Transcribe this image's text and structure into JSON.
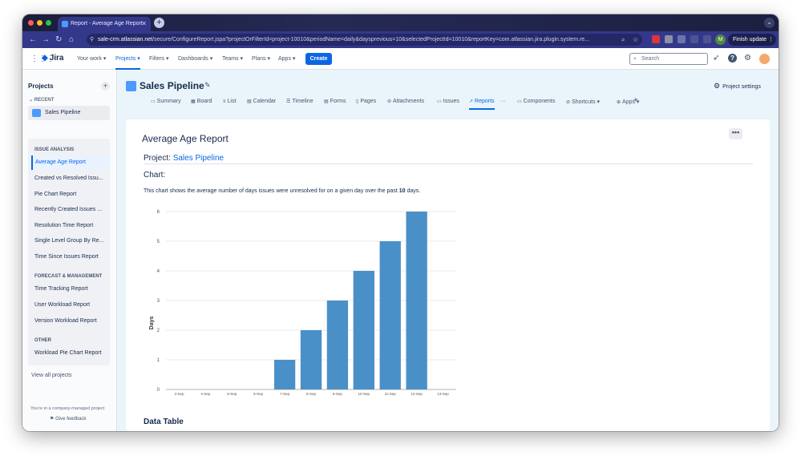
{
  "browser": {
    "tab_title": "Report - Average Age Report",
    "new_tab_symbol": "+",
    "url_host": "sale-crm.atlassian.net",
    "url_path": "/secure/ConfigureReport.jspa?projectOrFilterId=project-10010&periodName=daily&daysprevious=10&selectedProjectId=10010&reportKey=com.atlassian.jira.plugin.system.re...",
    "profile_initial": "M",
    "finish_update_label": "Finish update"
  },
  "topnav": {
    "product_name": "Jira",
    "items": [
      {
        "label": "Your work ▾"
      },
      {
        "label": "Projects ▾"
      },
      {
        "label": "Filters ▾"
      },
      {
        "label": "Dashboards ▾"
      },
      {
        "label": "Teams ▾"
      },
      {
        "label": "Plans ▾"
      },
      {
        "label": "Apps ▾"
      }
    ],
    "create_label": "Create",
    "search_placeholder": "Search"
  },
  "sidebar": {
    "title": "Projects",
    "recent_label": "RECENT",
    "project_name": "Sales Pipeline",
    "issue_analysis_label": "ISSUE ANALYSIS",
    "issue_analysis_items": [
      {
        "label": "Average Age Report"
      },
      {
        "label": "Created vs Resolved Issu..."
      },
      {
        "label": "Pie Chart Report"
      },
      {
        "label": "Recently Created Issues ..."
      },
      {
        "label": "Resolution Time Report"
      },
      {
        "label": "Single Level Group By Re..."
      },
      {
        "label": "Time Since Issues Report"
      }
    ],
    "forecast_label": "FORECAST & MANAGEMENT",
    "forecast_items": [
      {
        "label": "Time Tracking Report"
      },
      {
        "label": "User Workload Report"
      },
      {
        "label": "Version Workload Report"
      }
    ],
    "other_label": "OTHER",
    "other_items": [
      {
        "label": "Workload Pie Chart Report"
      }
    ],
    "view_all_label": "View all projects",
    "footer_text": "You're in a company-managed project",
    "feedback_label": "Give feedback"
  },
  "project": {
    "title": "Sales Pipeline",
    "settings_label": "Project settings",
    "tabs": [
      {
        "label": "Summary"
      },
      {
        "label": "Board"
      },
      {
        "label": "List"
      },
      {
        "label": "Calendar"
      },
      {
        "label": "Timeline"
      },
      {
        "label": "Forms"
      },
      {
        "label": "Pages"
      },
      {
        "label": "Attachments"
      },
      {
        "label": "Issues"
      },
      {
        "label": "Reports"
      },
      {
        "label": "···"
      },
      {
        "label": "Components"
      },
      {
        "label": "Shortcuts ▾"
      },
      {
        "label": "Apps ▾"
      }
    ]
  },
  "report": {
    "title": "Average Age Report",
    "project_label": "Project:",
    "project_link": "Sales Pipeline",
    "chart_heading": "Chart:",
    "description_prefix": "This chart shows the average number of days issues were unresolved for on a given day over the past",
    "description_days": "10",
    "description_suffix": "days.",
    "data_table_heading": "Data Table",
    "menu_symbol": "•••"
  },
  "chart_data": {
    "type": "bar",
    "categories": [
      "3-Sep",
      "4-Sep",
      "5-Sep",
      "6-Sep",
      "7-Sep",
      "8-Sep",
      "9-Sep",
      "10-Sep",
      "11-Sep",
      "12-Sep",
      "13-Sep"
    ],
    "values": [
      0,
      0,
      0,
      0,
      1,
      2,
      3,
      4,
      5,
      6,
      0
    ],
    "ylabel": "Days",
    "ylim": [
      0,
      6
    ],
    "yticks": [
      0,
      1,
      2,
      3,
      4,
      5,
      6
    ],
    "grid": true,
    "bar_color": "#4a90c8"
  }
}
